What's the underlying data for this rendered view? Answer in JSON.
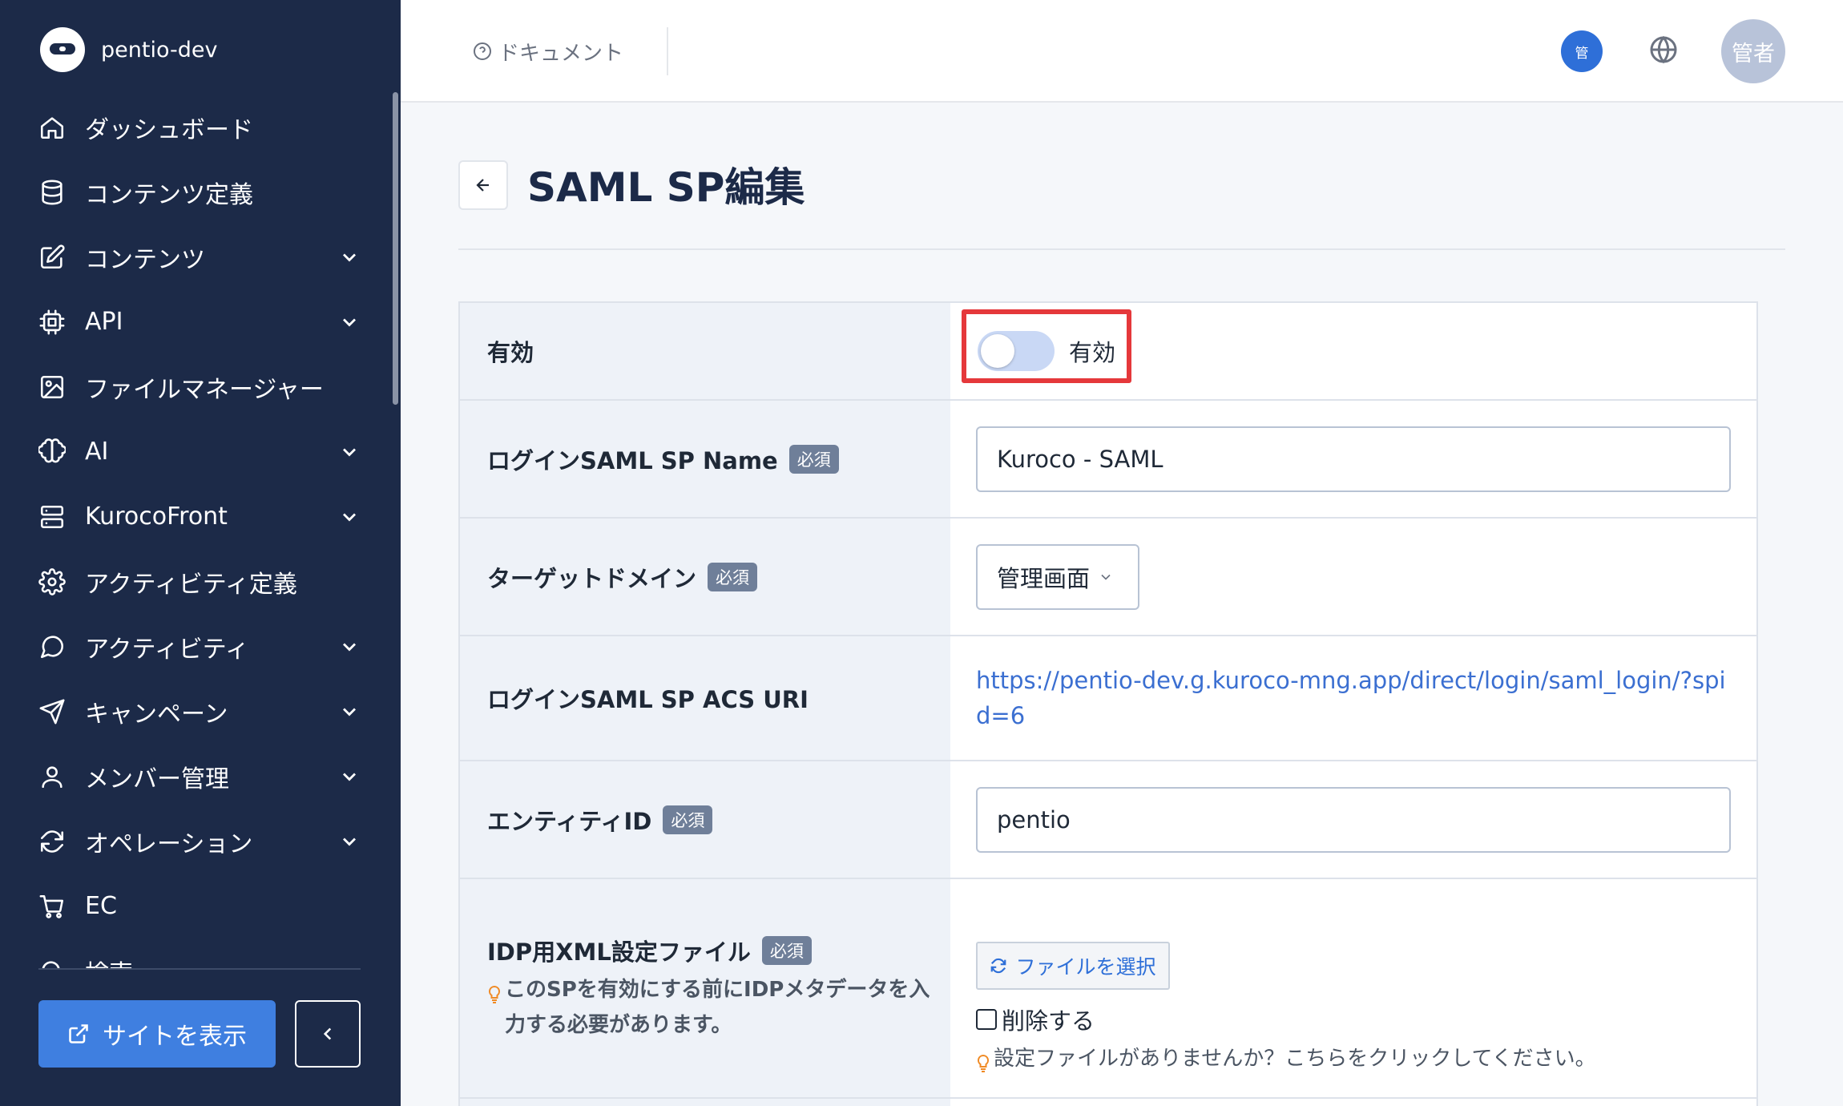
{
  "brand": {
    "name": "pentio-dev"
  },
  "sidebar": {
    "items": [
      {
        "label": "ダッシュボード",
        "icon": "home-icon",
        "has_children": false
      },
      {
        "label": "コンテンツ定義",
        "icon": "database-icon",
        "has_children": false
      },
      {
        "label": "コンテンツ",
        "icon": "edit-icon",
        "has_children": true
      },
      {
        "label": "API",
        "icon": "cpu-icon",
        "has_children": true
      },
      {
        "label": "ファイルマネージャー",
        "icon": "image-icon",
        "has_children": false
      },
      {
        "label": "AI",
        "icon": "brain-icon",
        "has_children": true
      },
      {
        "label": "KurocoFront",
        "icon": "server-icon",
        "has_children": true
      },
      {
        "label": "アクティビティ定義",
        "icon": "gear-icon",
        "has_children": false
      },
      {
        "label": "アクティビティ",
        "icon": "chat-icon",
        "has_children": true
      },
      {
        "label": "キャンペーン",
        "icon": "send-icon",
        "has_children": true
      },
      {
        "label": "メンバー管理",
        "icon": "user-icon",
        "has_children": true
      },
      {
        "label": "オペレーション",
        "icon": "refresh-icon",
        "has_children": true
      },
      {
        "label": "EC",
        "icon": "cart-icon",
        "has_children": false
      },
      {
        "label": "検索",
        "icon": "search-icon",
        "has_children": false
      }
    ],
    "site_button": "サイトを表示"
  },
  "header": {
    "doc_link": "ドキュメント",
    "admin_badge": "管",
    "avatar": "管者"
  },
  "page": {
    "title": "SAML SP編集"
  },
  "form": {
    "required_label": "必須",
    "enabled": {
      "label": "有効",
      "toggle_text": "有効",
      "value": false
    },
    "sp_name": {
      "label": "ログインSAML SP Name",
      "value": "Kuroco - SAML"
    },
    "target_domain": {
      "label": "ターゲットドメイン",
      "value": "管理画面"
    },
    "acs_uri": {
      "label": "ログインSAML SP ACS URI",
      "value": "https://pentio-dev.g.kuroco-mng.app/direct/login/saml_login/?spid=6"
    },
    "entity_id": {
      "label": "エンティティID",
      "value": "pentio"
    },
    "idp_xml": {
      "label": "IDP用XML設定ファイル",
      "note": "このSPを有効にする前にIDPメタデータを入力する必要があります。",
      "file_button": "ファイルを選択",
      "delete_label": "削除する",
      "help": "設定ファイルがありませんか？こちらをクリックしてください。"
    }
  },
  "colors": {
    "sidebar_bg": "#1c2a48",
    "accent": "#3f7fe0",
    "highlight": "#e5383b"
  }
}
